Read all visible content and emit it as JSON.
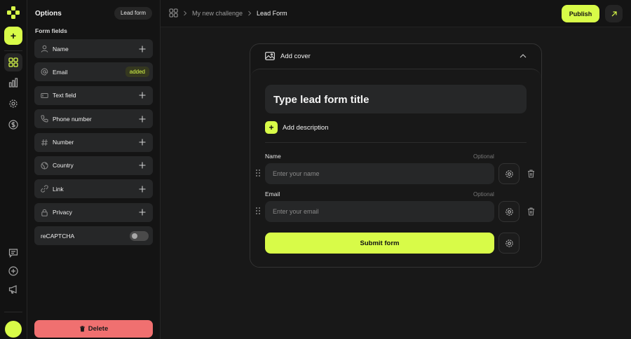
{
  "rail": {
    "items": [
      "grid-icon",
      "bar-chart-icon",
      "gear-icon",
      "dollar-icon"
    ],
    "bottom_items": [
      "chat-icon",
      "plus-circle-icon",
      "megaphone-icon"
    ],
    "accent": "#d8fb48"
  },
  "panel": {
    "title": "Options",
    "tag": "Lead form",
    "section": "Form fields",
    "fields": [
      {
        "label": "Name",
        "icon": "user-icon",
        "state": "add"
      },
      {
        "label": "Email",
        "icon": "at-icon",
        "state": "added",
        "badge": "added"
      },
      {
        "label": "Text field",
        "icon": "text-field-icon",
        "state": "add"
      },
      {
        "label": "Phone number",
        "icon": "phone-icon",
        "state": "add"
      },
      {
        "label": "Number",
        "icon": "hash-icon",
        "state": "add"
      },
      {
        "label": "Country",
        "icon": "globe-icon",
        "state": "add"
      },
      {
        "label": "Link",
        "icon": "link-icon",
        "state": "add"
      },
      {
        "label": "Privacy",
        "icon": "lock-icon",
        "state": "add"
      },
      {
        "label": "reCAPTCHA",
        "state": "toggle",
        "toggle_on": false
      }
    ],
    "delete_label": "Delete",
    "delete_color": "#f07070"
  },
  "topbar": {
    "breadcrumbs": [
      "My new challenge",
      "Lead Form"
    ],
    "publish_label": "Publish"
  },
  "form": {
    "cover_label": "Add cover",
    "title_placeholder": "Type lead form title",
    "add_description_label": "Add description",
    "fields": [
      {
        "label": "Name",
        "optional": "Optional",
        "placeholder": "Enter your name"
      },
      {
        "label": "Email",
        "optional": "Optional",
        "placeholder": "Enter your email"
      }
    ],
    "submit_label": "Submit form"
  }
}
